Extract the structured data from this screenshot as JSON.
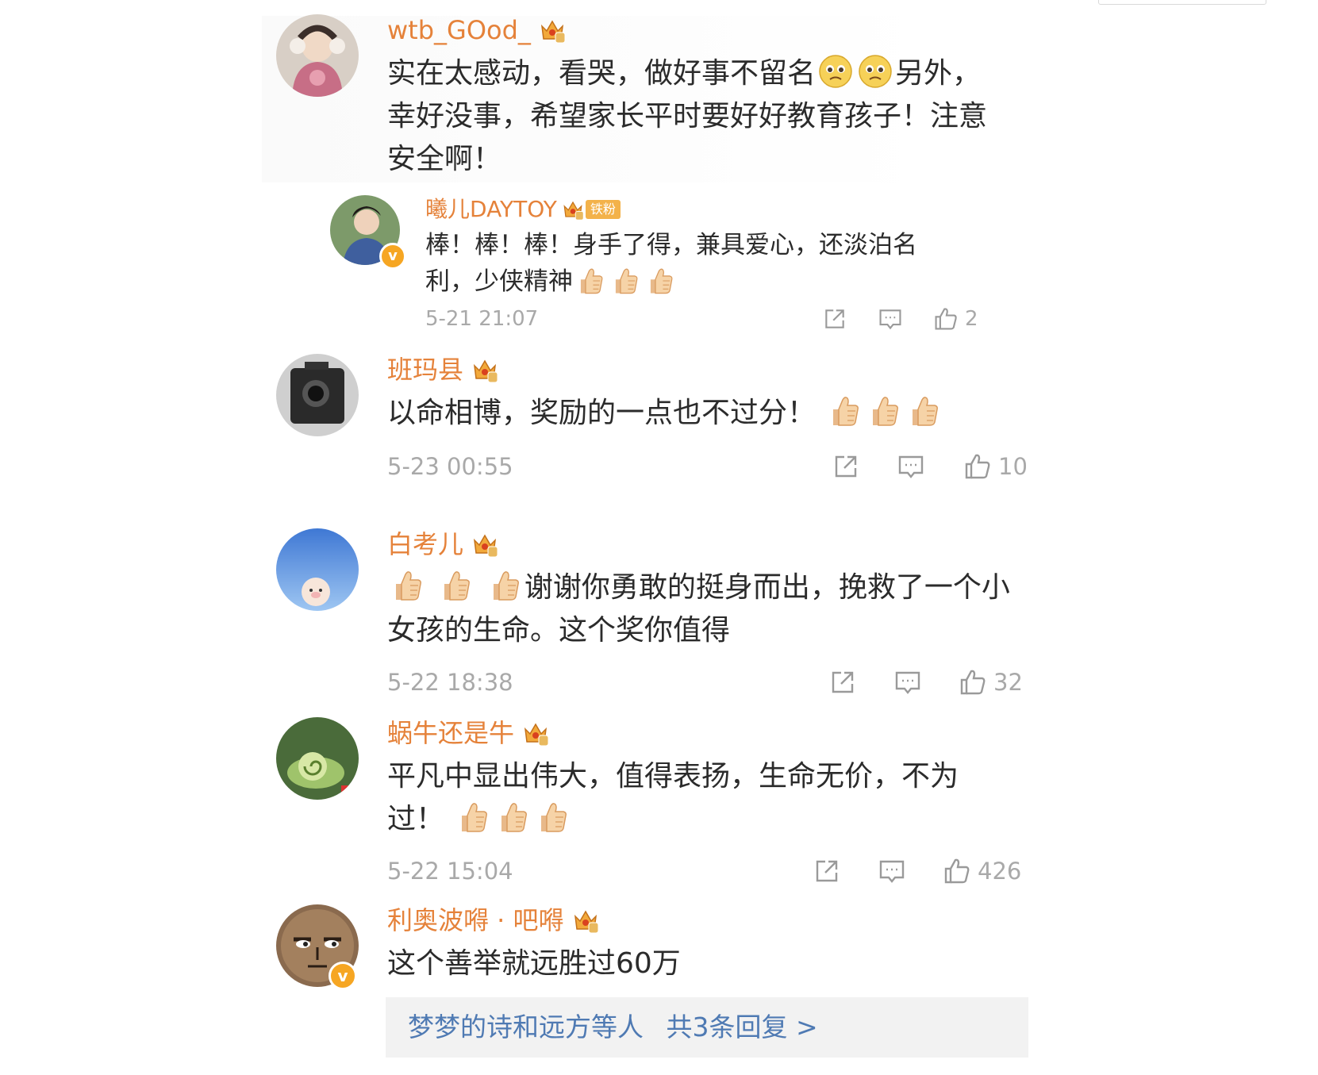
{
  "comments": [
    {
      "username": "wtb_GOod_",
      "text": "实在太感动，看哭，做好事不留名",
      "text_after": "另外，\n幸好没事，希望家长平时要好好教育孩子！注意\n安全啊！",
      "emojis": [
        "sad-face",
        "sad-face"
      ]
    },
    {
      "username": "班玛县",
      "text": "以命相博，奖励的一点也不过分！",
      "emojis": [
        "thumbs-up",
        "thumbs-up",
        "thumbs-up"
      ],
      "time": "5-23 00:55",
      "likes": "10"
    },
    {
      "username": "白考儿",
      "text": "谢谢你勇敢的挺身而出，挽救了一个小\n女孩的生命。这个奖你值得",
      "emojis": [
        "thumbs-up",
        "thumbs-up",
        "thumbs-up"
      ],
      "time": "5-22 18:38",
      "likes": "32"
    },
    {
      "username": "蜗牛还是牛",
      "text": "平凡中显出伟大，值得表扬，生命无价，不为\n过！",
      "emojis": [
        "thumbs-up",
        "thumbs-up",
        "thumbs-up"
      ],
      "time": "5-22 15:04",
      "likes": "426"
    },
    {
      "username": "利奥波嘚 · 吧嘚",
      "text": "这个善举就远胜过60万"
    }
  ],
  "reply": {
    "username": "曦儿DAYTOY",
    "fan_badge": "铁粉",
    "verified_badge": "v",
    "text": "棒！棒！棒！身手了得，兼具爱心，还淡泊名\n利，少侠精神",
    "emojis": [
      "thumbs-up",
      "thumbs-up",
      "thumbs-up"
    ],
    "time": "5-21 21:07",
    "likes": "2"
  },
  "verified_badge_5": "v",
  "more_replies": {
    "prefix": "梦梦的诗和远方等人",
    "count_text": "共3条回复 >"
  },
  "colors": {
    "username": "#e5823a",
    "link": "#4f7ab3",
    "meta": "#a9a9a9",
    "text": "#2b2b2b"
  },
  "icons": [
    "share-icon",
    "comment-icon",
    "like-icon",
    "crown-icon",
    "thumbs-up-emoji",
    "sad-face-emoji"
  ]
}
